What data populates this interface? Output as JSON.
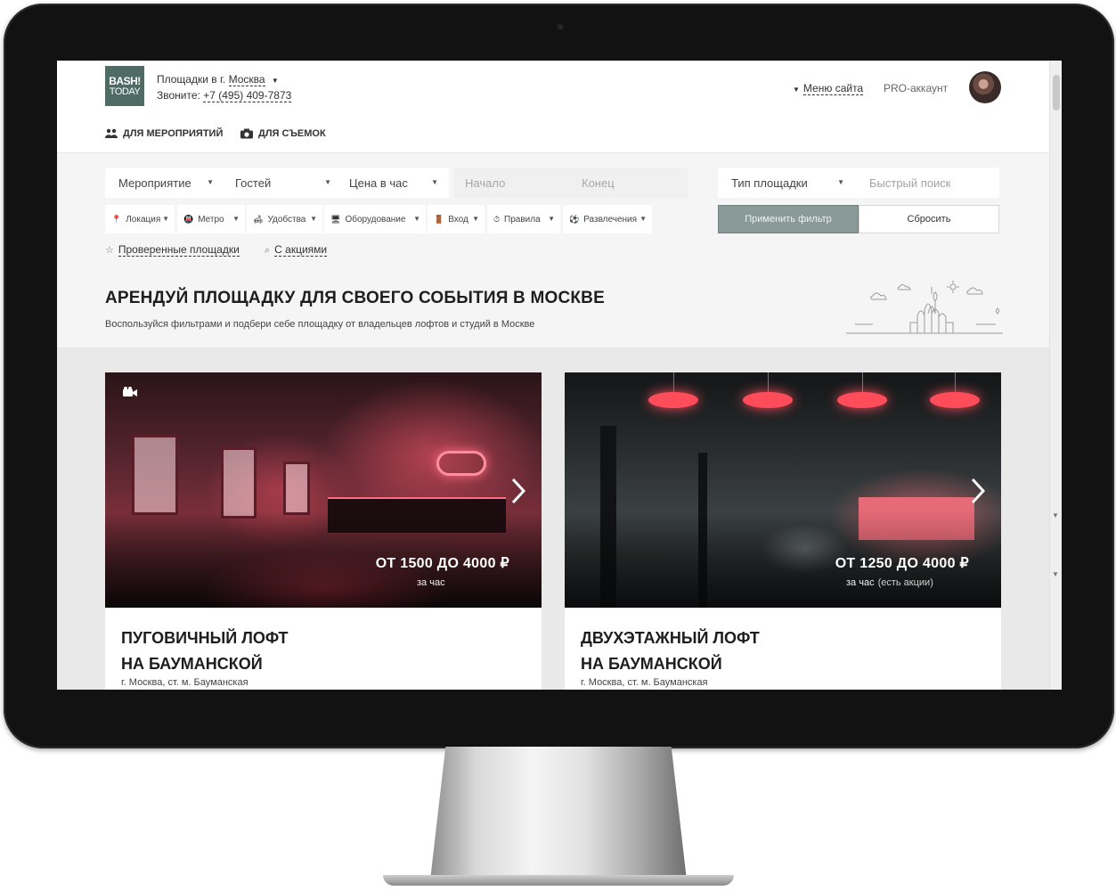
{
  "header": {
    "logo_line1": "BASH!",
    "logo_line2": "TODAY",
    "city_prefix": "Площадки в г.",
    "city": "Москва",
    "phone_prefix": "Звоните:",
    "phone": "+7 (495) 409-7873",
    "site_menu": "Меню сайта",
    "pro_account": "PRO-аккаунт"
  },
  "tabs": [
    {
      "label": "ДЛЯ МЕРОПРИЯТИЙ",
      "icon": "people-icon"
    },
    {
      "label": "ДЛЯ СЪЕМОК",
      "icon": "camera-icon"
    }
  ],
  "filters": {
    "event": "Мероприятие",
    "guests": "Гостей",
    "price": "Цена в час",
    "start": "Начало",
    "end": "Конец",
    "venue_type": "Тип площадки",
    "quick_search": "Быстрый поиск",
    "chips": [
      {
        "label": "Локация",
        "icon": "pin-icon"
      },
      {
        "label": "Метро",
        "icon": "metro-icon"
      },
      {
        "label": "Удобства",
        "icon": "sofa-icon"
      },
      {
        "label": "Оборудование",
        "icon": "monitor-icon"
      },
      {
        "label": "Вход",
        "icon": "door-icon"
      },
      {
        "label": "Правила",
        "icon": "clock-icon"
      },
      {
        "label": "Развлечения",
        "icon": "ball-icon"
      }
    ],
    "apply": "Применить фильтр",
    "reset": "Сбросить",
    "verified": "Проверенные площадки",
    "promo": "С акциями"
  },
  "hero": {
    "title": "АРЕНДУЙ ПЛОЩАДКУ ДЛЯ СВОЕГО СОБЫТИЯ В МОСКВЕ",
    "subtitle": "Воспользуйся фильтрами и подбери себе площадку от владельцев лофтов и студий в Москве"
  },
  "cards": [
    {
      "price": "ОТ 1500 ДО 4000 ₽",
      "price_unit": "за час",
      "promo_note": "",
      "title_line1": "ПУГОВИЧНЫЙ ЛОФТ",
      "title_line2": "НА БАУМАНСКОЙ",
      "address": "г. Москва, ст. м. Бауманская"
    },
    {
      "price": "ОТ 1250 ДО 4000 ₽",
      "price_unit": "за час",
      "promo_note": "(есть акции)",
      "title_line1": "ДВУХЭТАЖНЫЙ ЛОФТ",
      "title_line2": "НА БАУМАНСКОЙ",
      "address": "г. Москва, ст. м. Бауманская"
    }
  ],
  "colors": {
    "logo_bg": "#4f6b63",
    "apply_button": "#8a9a98",
    "neon_accent": "#ff4c5b"
  }
}
